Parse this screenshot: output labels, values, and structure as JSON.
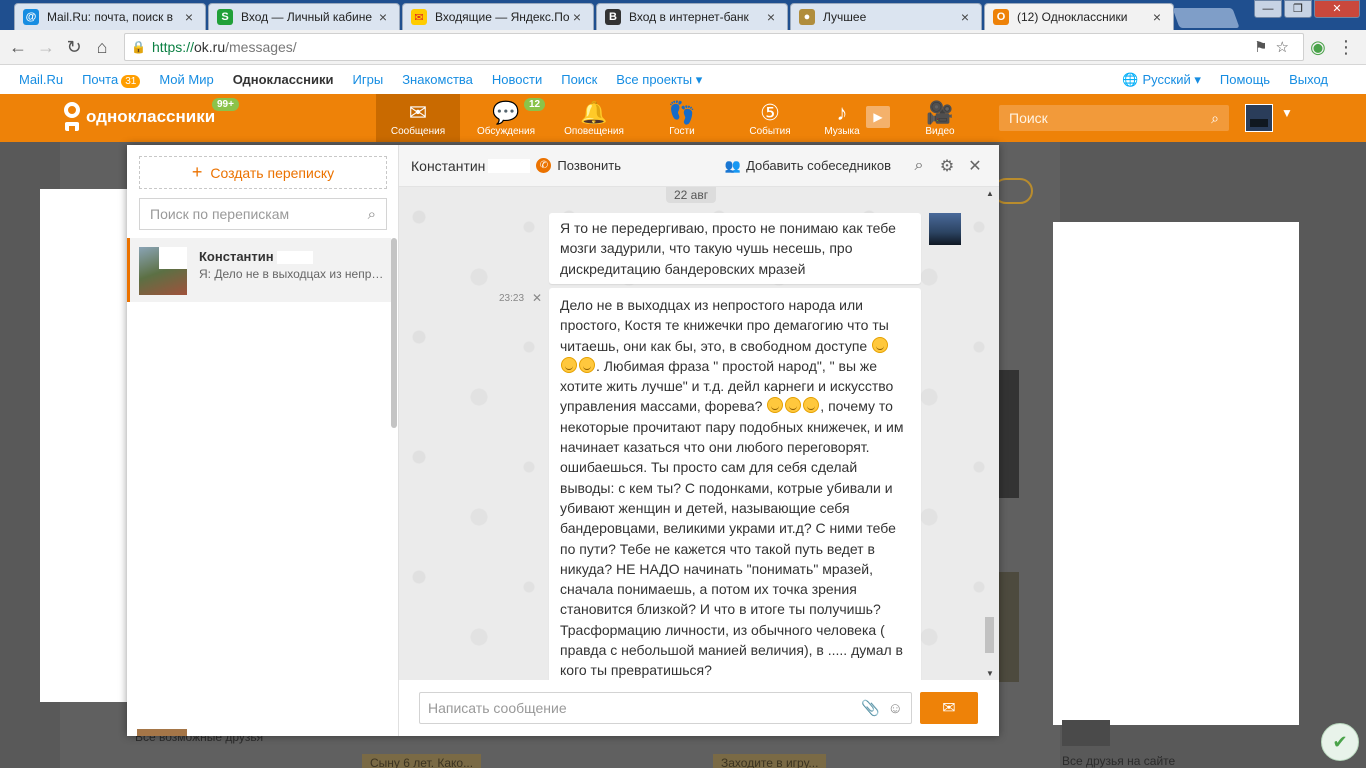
{
  "browser": {
    "tabs": [
      {
        "title": "Mail.Ru: почта, поиск в",
        "favicon": "mailru-at-icon",
        "color": "#168de2",
        "glyph": "@"
      },
      {
        "title": "Вход — Личный кабине",
        "favicon": "sberbank-icon",
        "color": "#21a038",
        "glyph": "S"
      },
      {
        "title": "Входящие — Яндекс.По",
        "favicon": "yandex-mail-icon",
        "color": "#ffcc00",
        "glyph": "✉"
      },
      {
        "title": "Вход в интернет-банк",
        "favicon": "bank-icon",
        "color": "#333333",
        "glyph": "В"
      },
      {
        "title": "Лучшее",
        "favicon": "coin-icon",
        "color": "#b08d3c",
        "glyph": "●"
      },
      {
        "title": "(12) Одноклассники",
        "favicon": "odnoklassniki-icon",
        "color": "#ee8208",
        "glyph": "О",
        "active": true
      }
    ],
    "window_buttons": {
      "minimize": "—",
      "maximize": "❐",
      "close": "✕"
    },
    "url_protocol": "https://",
    "url_host": "ok.ru",
    "url_path": "/messages/"
  },
  "portal": {
    "links": [
      "Mail.Ru",
      "Почта",
      "Мой Мир",
      "Одноклассники",
      "Игры",
      "Знакомства",
      "Новости",
      "Поиск",
      "Все проекты ▾"
    ],
    "mail_count": "31",
    "language": "Русский ▾",
    "help": "Помощь",
    "logout": "Выход"
  },
  "ok": {
    "brand": "одноклассники",
    "brand_badge": "99+",
    "nav": [
      {
        "label": "Сообщения",
        "icon": "envelope-icon",
        "glyph": "✉",
        "active": true
      },
      {
        "label": "Обсуждения",
        "icon": "chat-bubbles-icon",
        "glyph": "💬",
        "badge": "12"
      },
      {
        "label": "Оповещения",
        "icon": "bell-icon",
        "glyph": "🔔"
      },
      {
        "label": "Гости",
        "icon": "footprints-icon",
        "glyph": "👣"
      },
      {
        "label": "События",
        "icon": "events-five-icon",
        "glyph": "⑤"
      },
      {
        "label": "Музыка",
        "icon": "music-note-icon",
        "glyph": "♪"
      },
      {
        "label": "Видео",
        "icon": "video-camera-icon",
        "glyph": "🎥"
      }
    ],
    "search_placeholder": "Поиск"
  },
  "messages": {
    "create_label": "Создать переписку",
    "search_placeholder": "Поиск по переписка​м",
    "chats": [
      {
        "name": "Константин",
        "last": "Я: Дело не в выходцах из непростого народа или"
      }
    ],
    "conversation": {
      "name": "Константин",
      "call_label": "Позвонить",
      "add_label": "Добавить собеседников",
      "date": "22 авг",
      "messages": [
        {
          "text": "Я то не передергиваю, просто не понимаю как тебе мозги задурили, что такую чушь несешь, про дискредитацию бандеровских мразей"
        },
        {
          "time": "23:23",
          "part1": "Дело не в выходцах из непростого народа или простого, Костя те книжечки про демагогию что ты читаешь, они как бы, это, в свободном доступе",
          "part2": ". Любимая фраза \" простой народ\", \" вы же хотите жить лучше\" и т.д. дейл карнеги и искусство управления массами, форева?",
          "part3": ", почему то некоторые прочитают пару подобных книжечек, и им начинает казаться что они любого переговорят. ошибаешься. Ты просто сам для себя сделай выводы:  с кем ты? С подонками, котрые убивали и убивают женщин и детей, называющие себя бандеровцами, великими украми ит.д? С ними тебе по пути? Тебе не кажется что такой путь ведет в никуда? НЕ НАДО  начинать \"понимать\" мразей, сначала понимаешь, а потом их точка зрения становится близкой? И что в итоге ты получишь? Трасформацию личности, из обычного человека ( правда с небольшой манией величия), в ..... думал в кого ты превратишься?"
        }
      ],
      "input_placeholder": "Написать сообщение"
    }
  },
  "background": {
    "friends_text": "Все возможные друзья",
    "friends_text_right": "Все друзья на сайте",
    "faded_btn_left": "Сыну 6 лет. Како...",
    "faded_btn_right": "Заходите в игру..."
  }
}
